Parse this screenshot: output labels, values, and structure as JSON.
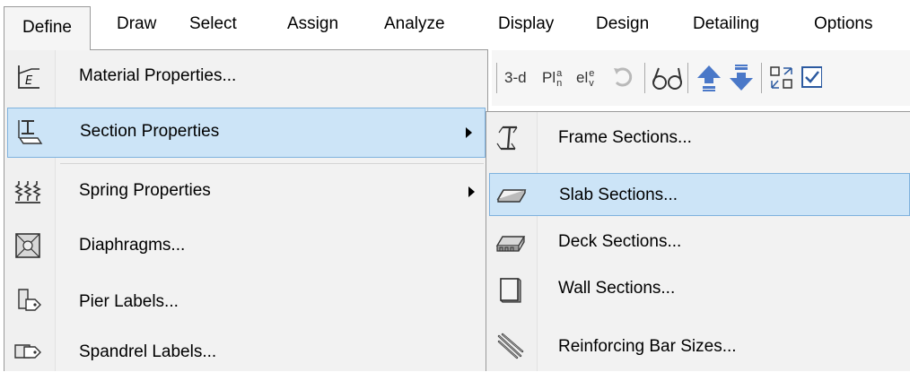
{
  "menubar": {
    "items": [
      {
        "label": "Define"
      },
      {
        "label": "Draw"
      },
      {
        "label": "Select"
      },
      {
        "label": "Assign"
      },
      {
        "label": "Analyze"
      },
      {
        "label": "Display"
      },
      {
        "label": "Design"
      },
      {
        "label": "Detailing"
      },
      {
        "label": "Options"
      }
    ]
  },
  "toolbar": {
    "view_3d": "3-d",
    "view_plan": "Pl",
    "view_elev": "el",
    "plan_sup": "a",
    "plan_sub": "n",
    "elev_sup": "e",
    "elev_sub": "v"
  },
  "define_menu": {
    "items": [
      {
        "label": "Material Properties...",
        "icon": "material-properties-icon"
      },
      {
        "label": "Section Properties",
        "icon": "section-properties-icon",
        "highlighted": true,
        "submenu": true
      },
      {
        "label": "Spring Properties",
        "icon": "spring-properties-icon",
        "submenu": true
      },
      {
        "label": "Diaphragms...",
        "icon": "diaphragm-icon"
      },
      {
        "label": "Pier Labels...",
        "icon": "pier-labels-icon"
      },
      {
        "label": "Spandrel Labels...",
        "icon": "spandrel-labels-icon"
      }
    ]
  },
  "section_submenu": {
    "items": [
      {
        "label": "Frame Sections...",
        "icon": "frame-section-icon"
      },
      {
        "label": "Slab Sections...",
        "icon": "slab-section-icon",
        "highlighted": true
      },
      {
        "label": "Deck Sections...",
        "icon": "deck-section-icon"
      },
      {
        "label": "Wall Sections...",
        "icon": "wall-section-icon"
      },
      {
        "label": "Reinforcing Bar Sizes...",
        "icon": "rebar-icon"
      }
    ]
  },
  "colors": {
    "highlight_fill": "#cce4f7",
    "highlight_border": "#7fb2de",
    "menu_bg": "#f2f2f2",
    "toolbar_arrow": "#4a78c8"
  }
}
